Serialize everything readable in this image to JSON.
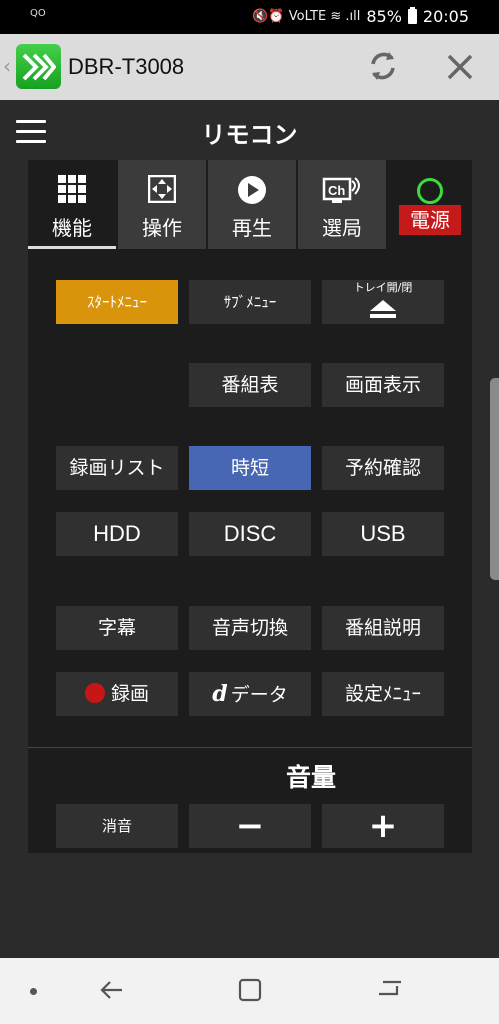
{
  "status_bar": {
    "left_indicator": "QO",
    "battery": "85%",
    "time": "20:05",
    "signal_icons": "🔇⏰ VoLTE ≋ .ıll"
  },
  "app_bar": {
    "title": "DBR-T3008",
    "icons": [
      "app-logo-icon",
      "refresh-icon",
      "close-icon"
    ]
  },
  "remote": {
    "title": "リモコン",
    "tabs": [
      {
        "label": "機能",
        "icon": "grid-icon",
        "active": true
      },
      {
        "label": "操作",
        "icon": "dpad-icon",
        "active": false
      },
      {
        "label": "再生",
        "icon": "play-icon",
        "active": false
      },
      {
        "label": "選局",
        "icon": "channel-icon",
        "active": false
      }
    ],
    "power_label": "電源",
    "buttons": {
      "start_menu": "ｽﾀｰﾄﾒﾆｭｰ",
      "sub_menu": "ｻﾌﾞﾒﾆｭｰ",
      "tray": "トレイ開/閉",
      "program_guide": "番組表",
      "screen_display": "画面表示",
      "recording_list": "録画リスト",
      "jitan": "時短",
      "reservation_check": "予約確認",
      "hdd": "HDD",
      "disc": "DISC",
      "usb": "USB",
      "subtitles": "字幕",
      "audio_switch": "音声切換",
      "program_info": "番組説明",
      "record": "録画",
      "data": "データ",
      "data_prefix": "d",
      "settings_menu": "設定ﾒﾆｭｰ",
      "mute": "消音",
      "volume_down": "−",
      "volume_up": "+"
    },
    "volume_label": "音量"
  },
  "colors": {
    "orange": "#d9940c",
    "blue": "#4767b5",
    "power_red": "#c41a1a",
    "power_green": "#3ddc3d",
    "app_green": "#22b02a"
  }
}
